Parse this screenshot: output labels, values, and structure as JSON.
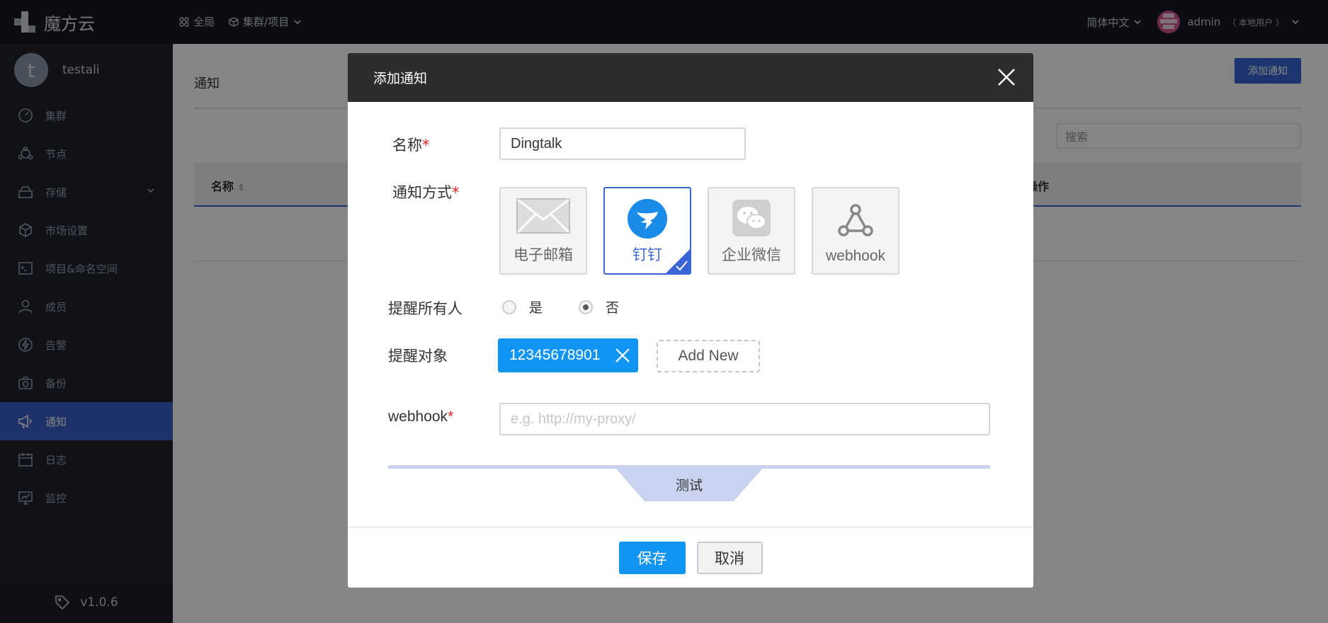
{
  "app": {
    "brand": "魔方云"
  },
  "topnav": {
    "global": "全局",
    "cluster_project": "集群/项目"
  },
  "topright": {
    "language": "简体中文",
    "username": "admin",
    "user_type": "（ 本地用户 ）"
  },
  "sidebar": {
    "user": {
      "initial": "t",
      "name": "testali"
    },
    "items": [
      {
        "label": "集群",
        "icon": "gauge-icon"
      },
      {
        "label": "节点",
        "icon": "nodes-icon"
      },
      {
        "label": "存储",
        "icon": "storage-icon"
      },
      {
        "label": "市场设置",
        "icon": "cube-icon"
      },
      {
        "label": "项目&命名空间",
        "icon": "terminal-icon"
      },
      {
        "label": "成员",
        "icon": "user-icon"
      },
      {
        "label": "告警",
        "icon": "lightning-icon"
      },
      {
        "label": "备份",
        "icon": "camera-icon"
      },
      {
        "label": "通知",
        "icon": "megaphone-icon",
        "active": true
      },
      {
        "label": "日志",
        "icon": "calendar-icon"
      },
      {
        "label": "监控",
        "icon": "monitor-icon"
      }
    ],
    "version": "v1.0.6"
  },
  "main": {
    "title": "通知",
    "add_button": "添加通知",
    "search_placeholder": "搜索",
    "table": {
      "col_name": "名称",
      "col_ops": "操作"
    }
  },
  "modal": {
    "title": "添加通知",
    "name_label": "名称",
    "name_value": "Dingtalk",
    "method_label": "通知方式",
    "methods": [
      {
        "label": "电子邮箱",
        "icon": "envelope-icon"
      },
      {
        "label": "钉钉",
        "icon": "dingtalk-icon",
        "selected": true
      },
      {
        "label": "企业微信",
        "icon": "wechat-icon"
      },
      {
        "label": "webhook",
        "icon": "webhook-icon"
      }
    ],
    "remind_all_label": "提醒所有人",
    "remind_all_options": [
      "是",
      "否"
    ],
    "remind_all_selected": "否",
    "remind_target_label": "提醒对象",
    "remind_targets": [
      "12345678901"
    ],
    "add_new": "Add New",
    "webhook_label": "webhook",
    "webhook_placeholder": "e.g. http://my-proxy/",
    "test_label": "测试",
    "save": "保存",
    "cancel": "取消"
  },
  "colors": {
    "accent": "#3966d4",
    "primary_button": "#1095f5",
    "topbar": "#161a26",
    "sidebar": "#20232e"
  }
}
